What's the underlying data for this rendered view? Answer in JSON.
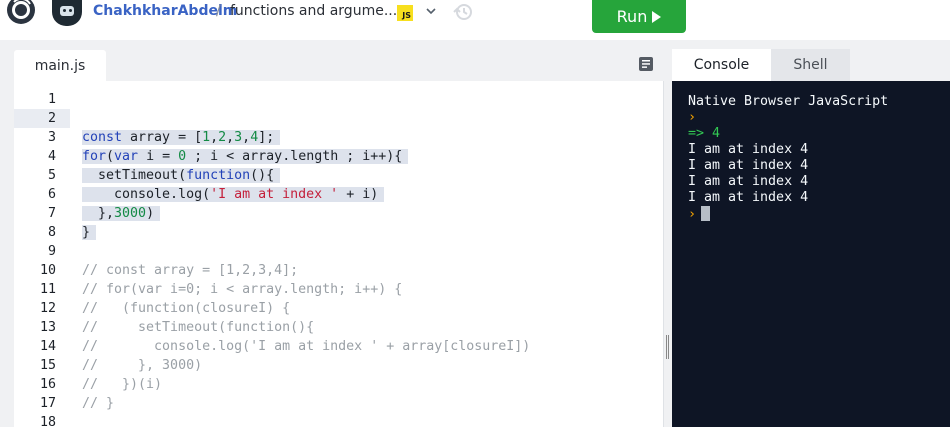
{
  "header": {
    "username": "ChakhkharAbdelm",
    "separator": "/",
    "repl_name": "functions and argume...",
    "language_badge": "JS",
    "run_label": "Run"
  },
  "editor": {
    "file_tab": "main.js",
    "line_numbers": [
      "1",
      "2",
      "3",
      "4",
      "5",
      "6",
      "7",
      "8",
      "9",
      "10",
      "11",
      "12",
      "13",
      "14",
      "15",
      "16",
      "17",
      "18"
    ],
    "active_line": 2,
    "code_lines": [
      "",
      "",
      "const array = [1,2,3,4];",
      "for(var i = 0 ; i < array.length ; i++){",
      "  setTimeout(function(){",
      "    console.log('I am at index ' + i)",
      "  },3000)",
      "}",
      "",
      "// const array = [1,2,3,4];",
      "// for(var i=0; i < array.length; i++) {",
      "//   (function(closureI) {",
      "//     setTimeout(function(){",
      "//       console.log('I am at index ' + array[closureI])",
      "//     }, 3000)",
      "//   })(i)",
      "// }",
      ""
    ]
  },
  "panes": {
    "tabs": [
      "Console",
      "Shell"
    ],
    "active_tab": "Console"
  },
  "console": {
    "header": "Native Browser JavaScript",
    "prompt_symbol": "›",
    "result_arrow": "=>",
    "result_value": "4",
    "output_lines": [
      "I am at index 4",
      "I am at index 4",
      "I am at index 4",
      "I am at index 4"
    ]
  },
  "colors": {
    "run_button": "#26a53b",
    "username": "#3a63c4",
    "console_bg": "#0e1525",
    "keyword": "#2342b8",
    "number": "#138a45",
    "string": "#c41f3a",
    "comment": "#9aa0a6"
  },
  "icons": [
    "replit-logo-icon",
    "avatar",
    "javascript-icon",
    "chevron-down-icon",
    "history-icon",
    "play-icon",
    "format-code-icon"
  ]
}
